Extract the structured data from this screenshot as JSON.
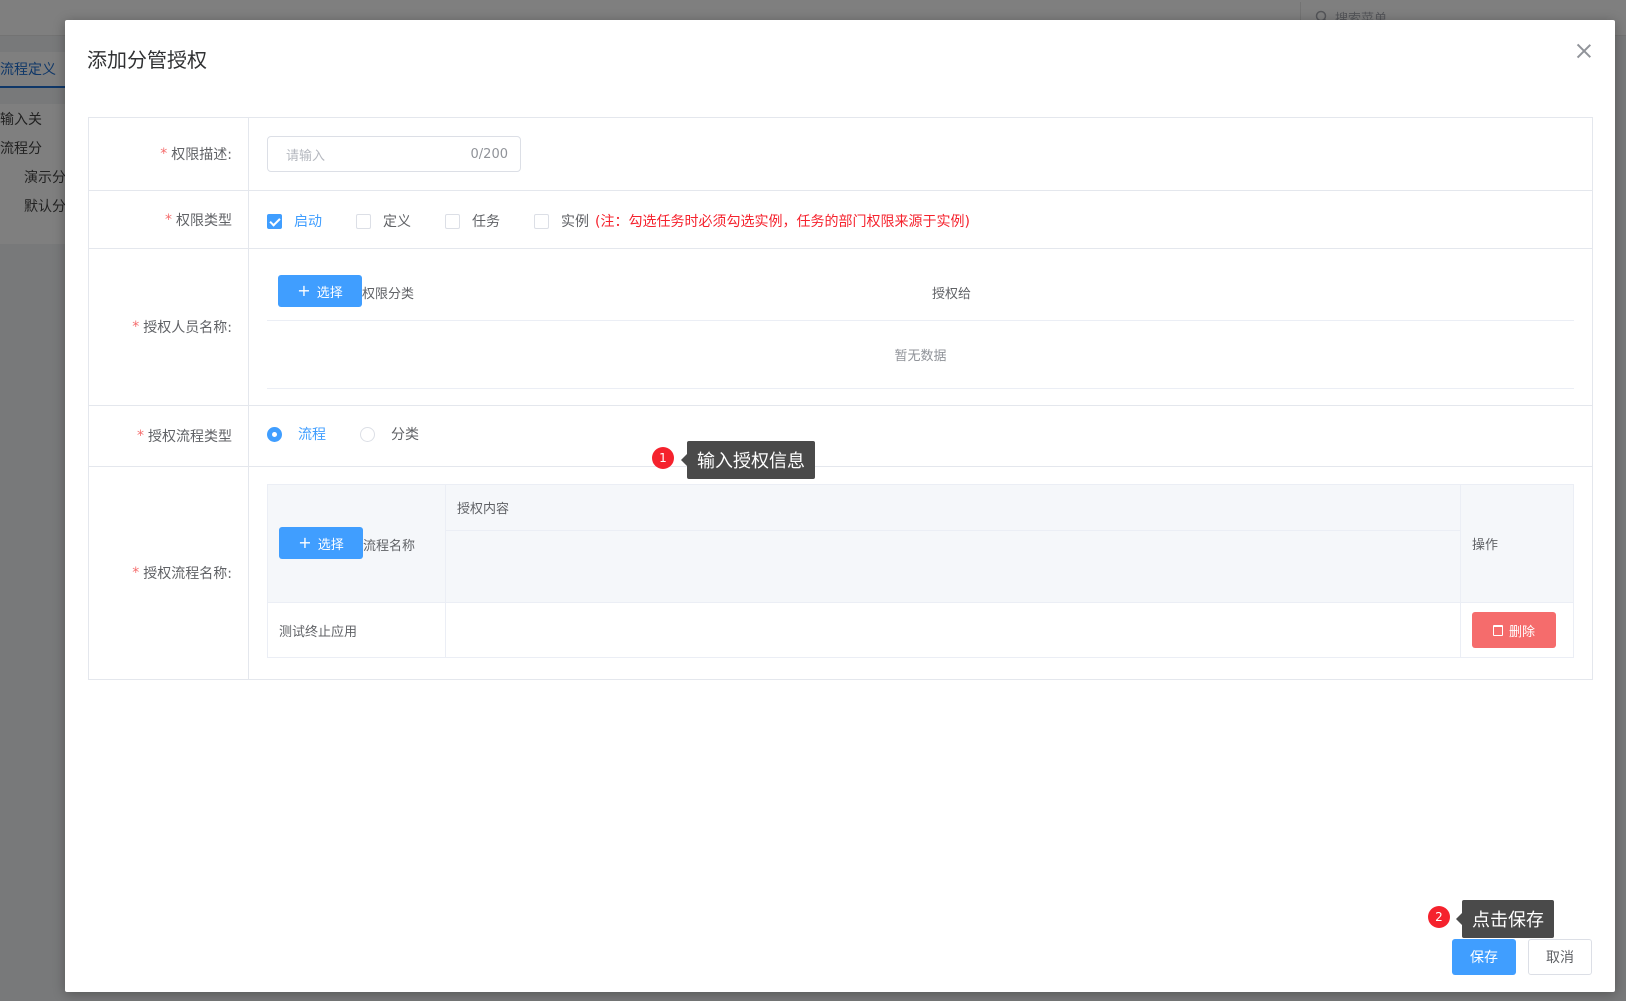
{
  "background": {
    "search_placeholder": "搜索菜单",
    "active_tab": "流程定义",
    "sidebar_items": [
      "输入关",
      "流程分",
      "演示分",
      "默认分"
    ]
  },
  "dialog": {
    "title": "添加分管授权",
    "fields": {
      "description": {
        "label": "权限描述:",
        "placeholder": "请输入",
        "counter": "0/200"
      },
      "permission_type": {
        "label": "权限类型",
        "options": [
          {
            "label": "启动",
            "checked": true
          },
          {
            "label": "定义",
            "checked": false
          },
          {
            "label": "任务",
            "checked": false
          },
          {
            "label": "实例",
            "checked": false
          }
        ],
        "note": "(注：勾选任务时必须勾选实例，任务的部门权限来源于实例)"
      },
      "grantee": {
        "label": "授权人员名称:",
        "select_button": "选择",
        "columns": [
          "权限分类",
          "授权给"
        ],
        "empty_text": "暂无数据"
      },
      "flow_type": {
        "label": "授权流程类型",
        "options": [
          {
            "label": "流程",
            "selected": true
          },
          {
            "label": "分类",
            "selected": false
          }
        ]
      },
      "flow_name": {
        "label": "授权流程名称:",
        "select_button": "选择",
        "columns": {
          "name": "流程名称",
          "content": "授权内容",
          "action": "操作"
        },
        "rows": [
          {
            "name": "测试终止应用",
            "action_label": "删除"
          }
        ]
      }
    },
    "footer": {
      "save_label": "保存",
      "cancel_label": "取消"
    }
  },
  "guide": {
    "step1": {
      "badge": "1",
      "text": "输入授权信息"
    },
    "step2": {
      "badge": "2",
      "text": "点击保存"
    }
  },
  "colors": {
    "primary": "#409eff",
    "danger": "#f56c6c",
    "required": "#f56c6c",
    "note": "#f5222d",
    "tooltip_bg": "#4a4a4a"
  }
}
